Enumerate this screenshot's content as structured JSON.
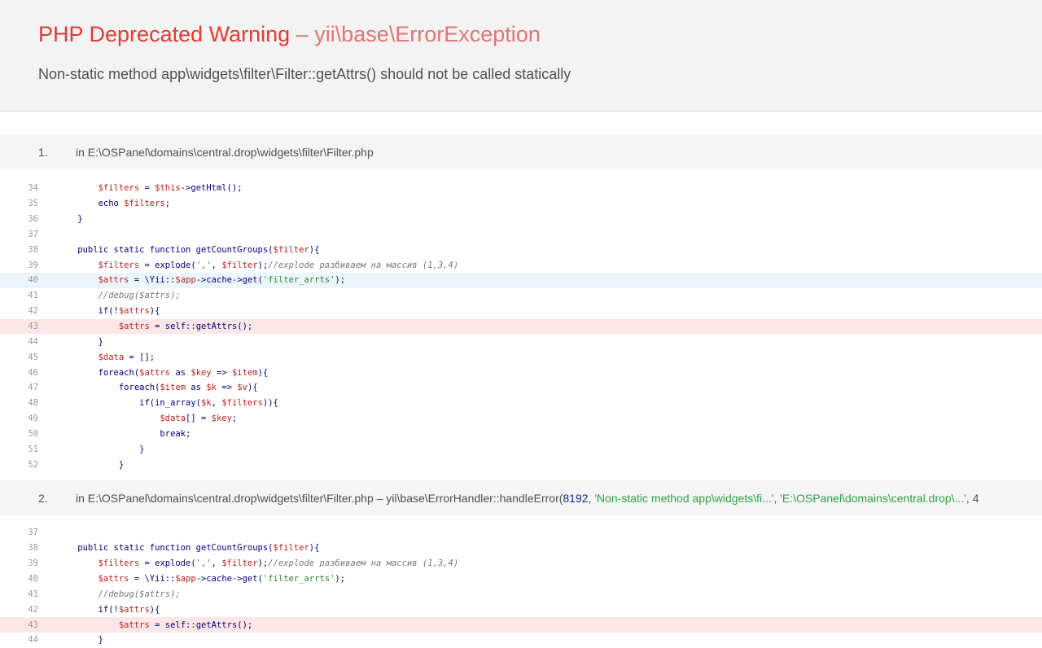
{
  "error": {
    "type": "PHP Deprecated Warning",
    "separator": "–",
    "exception": "yii\\base\\ErrorException",
    "message": "Non-static method app\\widgets\\filter\\Filter::getAttrs() should not be called statically"
  },
  "call_stack": [
    {
      "number": "1.",
      "info_prefix": "in E:\\OSPanel\\domains\\central.drop\\widgets\\filter\\Filter.php",
      "lines": [
        {
          "n": "34",
          "code": "        $filters = $this->getHtml();",
          "hl": ""
        },
        {
          "n": "35",
          "code": "        echo $filters;",
          "hl": ""
        },
        {
          "n": "36",
          "code": "    }",
          "hl": ""
        },
        {
          "n": "37",
          "code": "",
          "hl": ""
        },
        {
          "n": "38",
          "code": "    public static function getCountGroups($filter){",
          "hl": ""
        },
        {
          "n": "39",
          "code": "        $filters = explode(',', $filter);//explode разбиваем на массив (1,3,4)",
          "hl": ""
        },
        {
          "n": "40",
          "code": "        $attrs = \\Yii::$app->cache->get('filter_arrts');",
          "hl": "blue"
        },
        {
          "n": "41",
          "code": "        //debug($attrs);",
          "hl": ""
        },
        {
          "n": "42",
          "code": "        if(!$attrs){",
          "hl": ""
        },
        {
          "n": "43",
          "code": "            $attrs = self::getAttrs();",
          "hl": "red"
        },
        {
          "n": "44",
          "code": "        }",
          "hl": ""
        },
        {
          "n": "45",
          "code": "        $data = [];",
          "hl": ""
        },
        {
          "n": "46",
          "code": "        foreach($attrs as $key => $item){",
          "hl": ""
        },
        {
          "n": "47",
          "code": "            foreach($item as $k => $v){",
          "hl": ""
        },
        {
          "n": "48",
          "code": "                if(in_array($k, $filters)){",
          "hl": ""
        },
        {
          "n": "49",
          "code": "                    $data[] = $key;",
          "hl": ""
        },
        {
          "n": "50",
          "code": "                    break;",
          "hl": ""
        },
        {
          "n": "51",
          "code": "                }",
          "hl": ""
        },
        {
          "n": "52",
          "code": "            }",
          "hl": ""
        }
      ]
    },
    {
      "number": "2.",
      "info_prefix": "in E:\\OSPanel\\domains\\central.drop\\widgets\\filter\\Filter.php – yii\\base\\ErrorHandler::handleError(",
      "arg1": "8192",
      "comma1": ", ",
      "arg2": "'Non-static method app\\widgets\\fi...'",
      "comma2": ", ",
      "arg3": "'E:\\OSPanel\\domains\\central.drop\\...'",
      "comma3": ", 4",
      "lines": [
        {
          "n": "37",
          "code": "",
          "hl": ""
        },
        {
          "n": "38",
          "code": "    public static function getCountGroups($filter){",
          "hl": ""
        },
        {
          "n": "39",
          "code": "        $filters = explode(',', $filter);//explode разбиваем на массив (1,3,4)",
          "hl": ""
        },
        {
          "n": "40",
          "code": "        $attrs = \\Yii::$app->cache->get('filter_arrts');",
          "hl": ""
        },
        {
          "n": "41",
          "code": "        //debug($attrs);",
          "hl": ""
        },
        {
          "n": "42",
          "code": "        if(!$attrs){",
          "hl": ""
        },
        {
          "n": "43",
          "code": "            $attrs = self::getAttrs();",
          "hl": "red"
        },
        {
          "n": "44",
          "code": "        }",
          "hl": ""
        }
      ]
    }
  ]
}
